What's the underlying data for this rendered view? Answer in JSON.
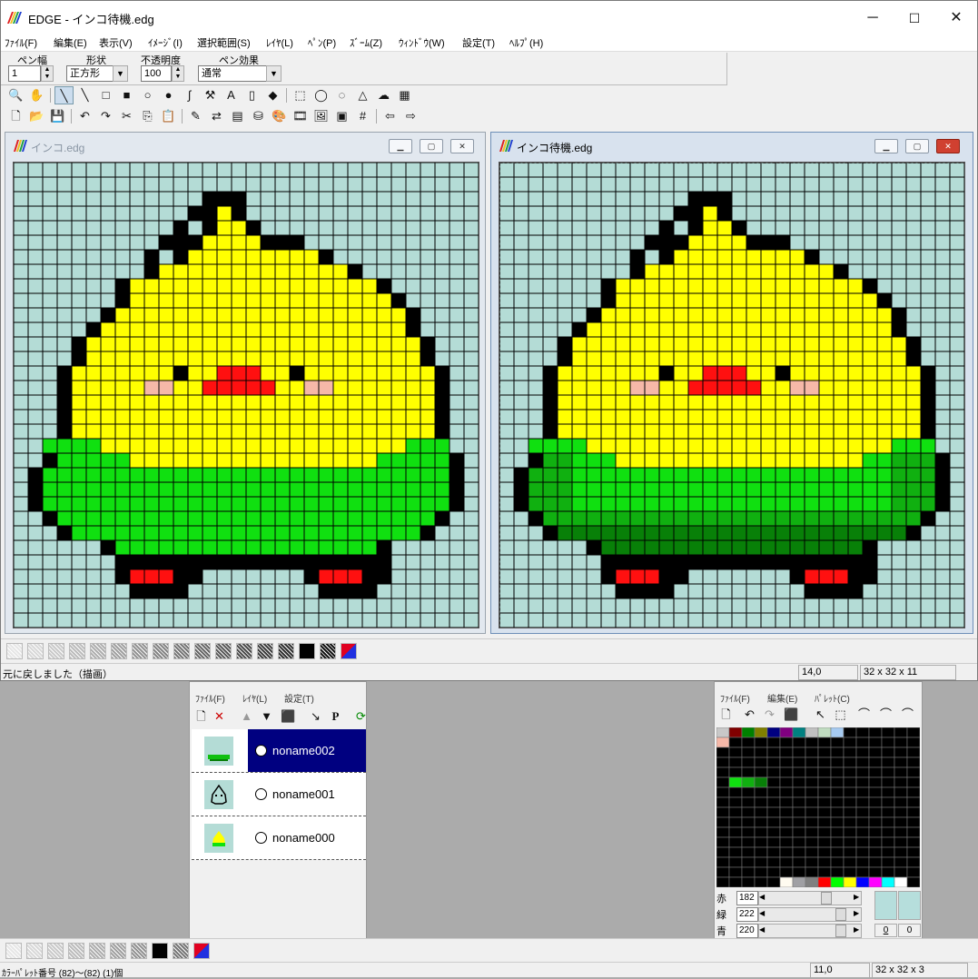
{
  "app": {
    "title": "EDGE - インコ待機.edg",
    "minimize": "─",
    "maximize": "☐",
    "close": "✕"
  },
  "menu": [
    "ﾌｧｲﾙ(F)",
    "編集(E)",
    "表示(V)",
    "ｲﾒｰｼﾞ(I)",
    "選択範囲(S)",
    "ﾚｲﾔ(L)",
    "ﾍﾟﾝ(P)",
    "ｽﾞｰﾑ(Z)",
    "ｳｨﾝﾄﾞｳ(W)",
    "設定(T)",
    "ﾍﾙﾌﾟ(H)"
  ],
  "options": {
    "pen_width_label": "ペン幅",
    "pen_width_value": "1",
    "shape_label": "形状",
    "shape_value": "正方形",
    "opacity_label": "不透明度",
    "opacity_value": "100",
    "effect_label": "ペン効果",
    "effect_value": "通常"
  },
  "toolbar_row1": [
    "magnifier-icon",
    "hand-icon",
    "pen-icon",
    "line-icon",
    "rect-outline-icon",
    "rect-filled-icon",
    "circle-outline-icon",
    "circle-filled-icon",
    "curve-icon",
    "hammer-icon",
    "text-icon",
    "bucket-icon",
    "eraser-icon",
    "select-rect-icon",
    "select-ellipse-icon",
    "lasso-icon",
    "polygon-select-icon",
    "magic-wand-icon",
    "grid-select-icon"
  ],
  "toolbar_row2": [
    "new-icon",
    "open-icon",
    "save-icon",
    "undo-icon",
    "redo-icon",
    "cut-icon",
    "copy-icon",
    "paste-icon",
    "eyedropper-icon",
    "replace-icon",
    "stripes-icon",
    "stamp-icon",
    "palette-icon",
    "film-icon",
    "image-icon",
    "frame-icon",
    "grid-icon",
    "prev-icon",
    "next-icon"
  ],
  "doc_left": {
    "title": "インコ.edg"
  },
  "doc_right": {
    "title": "インコ待機.edg"
  },
  "status": {
    "message": "元に戻しました（描画）",
    "coords": "14,0",
    "size": "32 x 32 x 11"
  },
  "layers_panel": {
    "menu": [
      "ﾌｧｲﾙ(F)",
      "ﾚｲﾔ(L)",
      "設定(T)"
    ],
    "layers": [
      {
        "name": "noname002",
        "selected": true
      },
      {
        "name": "noname001",
        "selected": false
      },
      {
        "name": "noname000",
        "selected": false
      }
    ]
  },
  "palette_panel": {
    "menu": [
      "ﾌｧｲﾙ(F)",
      "編集(E)",
      "ﾊﾟﾚｯﾄ(C)"
    ],
    "red_label": "赤",
    "green_label": "緑",
    "blue_label": "青",
    "red": "182",
    "green": "222",
    "blue": "220",
    "num_left": "0",
    "num_right": "0"
  },
  "bottom_status": {
    "message": "ｶﾗｰﾊﾟﾚｯﾄ番号 (82)〜(82) (1)個",
    "coords": "11,0",
    "size": "32 x 32 x 3"
  },
  "colors": {
    "canvas_bg": "#b4dcd6",
    "yellow": "#ffff00",
    "black": "#000000",
    "green": "#10e010",
    "dark_green": "#088008",
    "mid_green": "#10b010",
    "red": "#ff1010",
    "pink": "#f6b8a8",
    "selection": "#000080"
  }
}
